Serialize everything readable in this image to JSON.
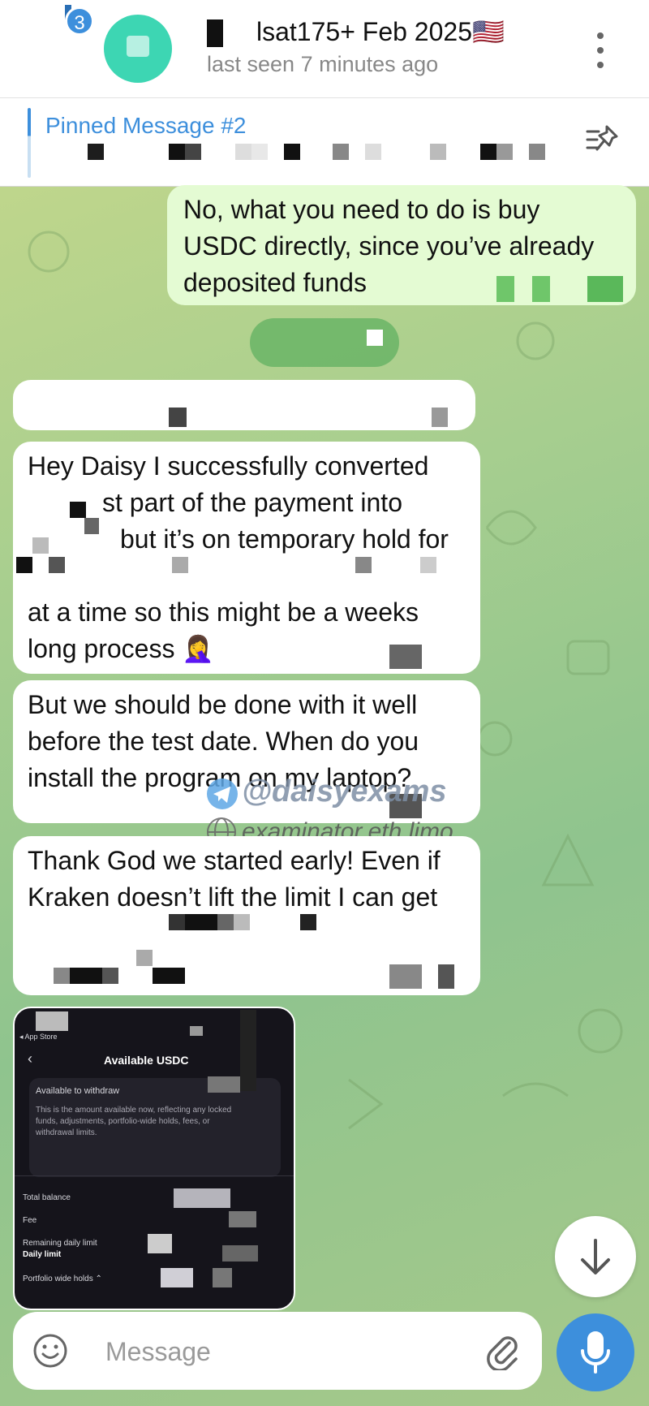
{
  "header": {
    "unread_count": "3",
    "title": "lsat175+ Feb 2025🇺🇸",
    "status": "last seen 7 minutes ago"
  },
  "pinned": {
    "label": "Pinned Message #2"
  },
  "messages": [
    {
      "direction": "outgoing",
      "lines": [
        "No, what you need to do is buy",
        "USDC directly, since you’ve already",
        "deposited funds"
      ]
    },
    {
      "direction": "incoming",
      "lines": [
        "Hey Daisy I successfully converted",
        "st part of the payment into",
        "but it’s on temporary hold for",
        "at a time so this might be a weeks",
        "long process 🤦‍♀️"
      ]
    },
    {
      "direction": "incoming",
      "lines": [
        "But we should be done with it well",
        "before the test date. When do you",
        "install the program on my laptop?"
      ]
    },
    {
      "direction": "incoming",
      "lines": [
        "Thank God we started early! Even if",
        "Kraken doesn’t lift the limit I can get"
      ]
    }
  ],
  "watermark": {
    "handle": "@daisyexams",
    "site": "examinator.eth.limo"
  },
  "screenshot": {
    "store_back": "◂ App Store",
    "title": "Available USDC",
    "card_title": "Available to withdraw",
    "card_text": [
      "This is the amount available now, reflecting any locked",
      "funds, adjustments, portfolio-wide holds, fees, or",
      "withdrawal limits."
    ],
    "rows": [
      "Total balance",
      "Fee",
      "Remaining daily limit",
      "Daily limit",
      "Portfolio wide holds ⌃"
    ]
  },
  "composer": {
    "placeholder": "Message"
  },
  "colors": {
    "accent": "#3d8fdc",
    "outgoing_bubble": "#e4fbd3",
    "incoming_bubble": "#ffffff",
    "avatar": "#3dd6b3"
  },
  "icons": [
    "more-vertical-icon",
    "unpin-list-icon",
    "scroll-down-icon",
    "emoji-icon",
    "paperclip-icon",
    "microphone-icon",
    "telegram-icon",
    "globe-icon"
  ]
}
